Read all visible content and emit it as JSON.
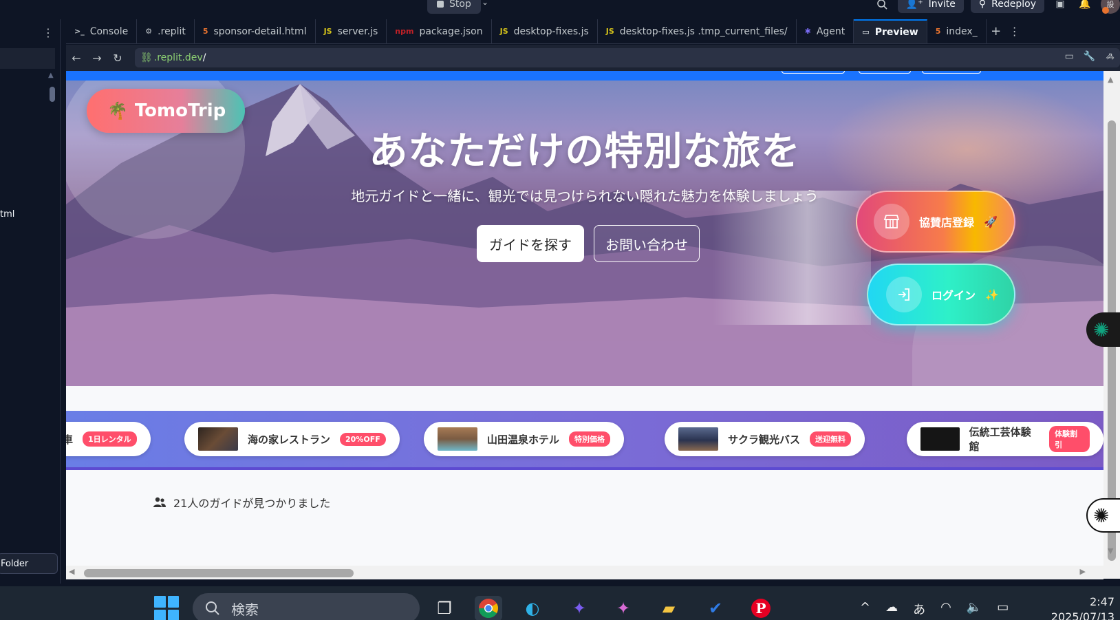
{
  "topbar": {
    "stop_label": "Stop",
    "invite_label": "Invite",
    "redeploy_label": "Redeploy",
    "avatar_text": "設"
  },
  "sidebar": {
    "file_fragment": "tml",
    "folder_label": "Folder"
  },
  "tabs": [
    {
      "label": "Console",
      "icon": ">_",
      "color": "#c2c8cc"
    },
    {
      "label": ".replit",
      "icon": "⚙",
      "color": "#9da2a6"
    },
    {
      "label": "sponsor-detail.html",
      "icon": "5",
      "color": "#e8732f"
    },
    {
      "label": "server.js",
      "icon": "JS",
      "color": "#d4c21a"
    },
    {
      "label": "package.json",
      "icon": "npm",
      "color": "#c12127"
    },
    {
      "label": "desktop-fixes.js",
      "icon": "JS",
      "color": "#d4c21a"
    },
    {
      "label": "desktop-fixes.js .tmp_current_files/",
      "icon": "JS",
      "color": "#d4c21a"
    },
    {
      "label": "Agent",
      "icon": "✱",
      "color": "#7b6cf6"
    },
    {
      "label": "Preview",
      "icon": "▭",
      "color": "#f5f9fc"
    },
    {
      "label": "index_",
      "icon": "5",
      "color": "#e8732f"
    }
  ],
  "url": {
    "domain": ".replit.dev",
    "path": "/"
  },
  "hero": {
    "brand": "TomoTrip",
    "title": "あなただけの特別な旅を",
    "subtitle": "地元ガイドと一緒に、観光では見つけられない隠れた魅力を体験しましょう",
    "btn_find": "ガイドを探す",
    "btn_contact": "お問い合わせ",
    "sponsor_label": "協賛店登録",
    "login_label": "ログイン"
  },
  "sponsors": [
    {
      "name": "転車",
      "badge": "1日レンタル",
      "thumb": "#ffffff"
    },
    {
      "name": "海の家レストラン",
      "badge": "20%OFF",
      "thumb": "#4a3a2e"
    },
    {
      "name": "山田温泉ホテル",
      "badge": "特別価格",
      "thumb": "#8a6a4c"
    },
    {
      "name": "サクラ観光バス",
      "badge": "送迎無料",
      "thumb": "#3c4766"
    },
    {
      "name": "伝統工芸体験館",
      "badge": "体験割引",
      "thumb": "#151515"
    }
  ],
  "results": {
    "text": "21人のガイドが見つかりました"
  },
  "taskbar": {
    "search_placeholder": "検索",
    "ime": "あ",
    "time": "2:47",
    "date": "2025/07/13"
  }
}
